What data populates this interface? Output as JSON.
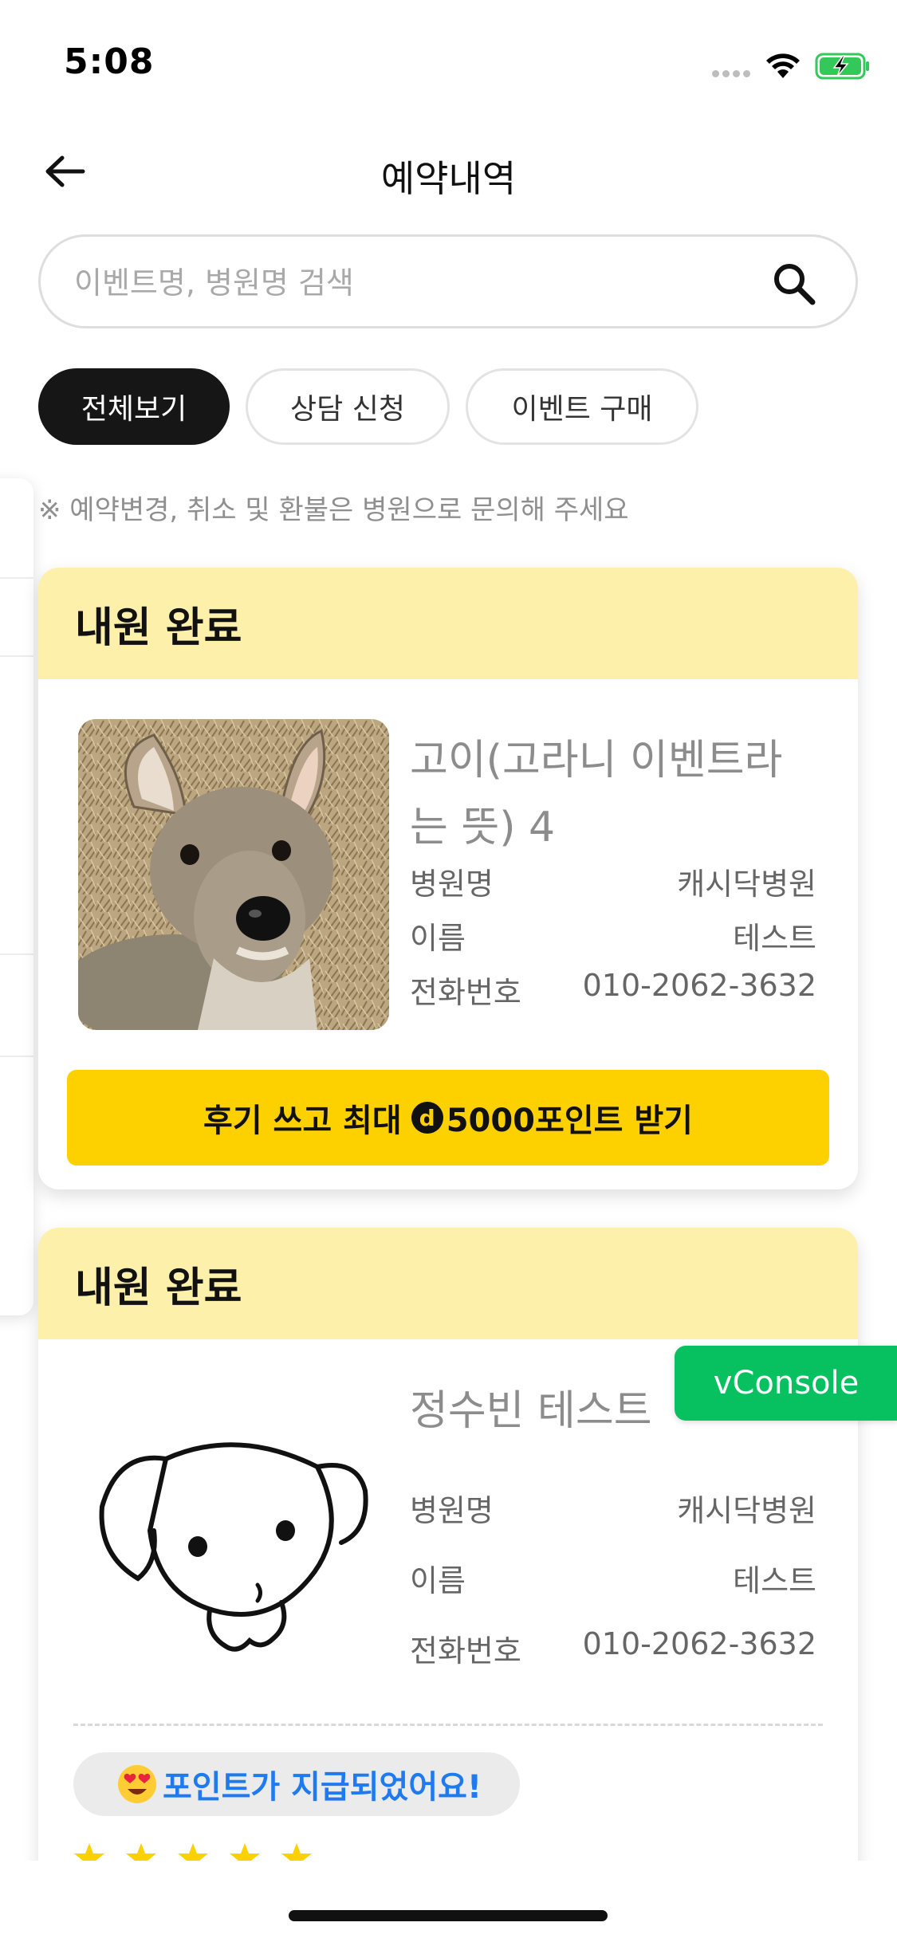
{
  "status_bar": {
    "time": "5:08"
  },
  "header": {
    "title": "예약내역"
  },
  "search": {
    "placeholder": "이벤트명, 병원명 검색"
  },
  "filters": [
    {
      "label": "전체보기",
      "active": true
    },
    {
      "label": "상담 신청",
      "active": false
    },
    {
      "label": "이벤트 구매",
      "active": false
    }
  ],
  "notice": "※ 예약변경, 취소 및 환불은 병원으로 문의해 주세요",
  "info_labels": {
    "hospital": "병원명",
    "name": "이름",
    "phone": "전화번호"
  },
  "cards": [
    {
      "status": "내원 완료",
      "title_line1": "고이(고라니 이벤트라",
      "title_line2": "는 뜻) 4",
      "hospital": "캐시닥병원",
      "name": "테스트",
      "phone": "010-2062-3632",
      "review_button": {
        "prefix": "후기 쓰고 최대",
        "badge": "d",
        "suffix": "5000포인트 받기"
      }
    },
    {
      "status": "내원 완료",
      "title": "정수빈 테스트",
      "hospital": "캐시닥병원",
      "name": "테스트",
      "phone": "010-2062-3632",
      "point_message": "포인트가 지급되었어요!"
    }
  ],
  "vconsole": {
    "label": "vConsole"
  },
  "colors": {
    "accent_yellow": "#fdd000",
    "card_header": "#fdf0aa",
    "point_blue": "#1f7af0",
    "vconsole_green": "#07c160"
  }
}
